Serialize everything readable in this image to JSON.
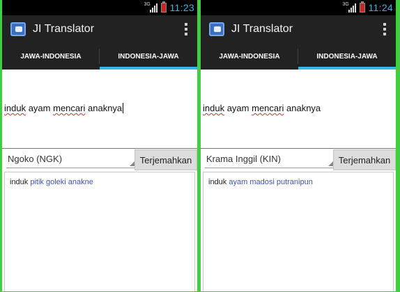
{
  "screens": [
    {
      "status": {
        "network": "3G",
        "time": "11:23"
      },
      "app_title": "JI Translator",
      "tabs": [
        "JAWA-INDONESIA",
        "INDONESIA-JAWA"
      ],
      "active_tab": 1,
      "input": {
        "words": [
          "induk",
          "ayam",
          "mencari",
          "anaknya"
        ]
      },
      "language_select": "Ngoko (NGK)",
      "translate_button": "Terjemahkan",
      "output": {
        "first": "induk",
        "rest": "pitik goleki anakne"
      }
    },
    {
      "status": {
        "network": "3G",
        "time": "11:24"
      },
      "app_title": "JI Translator",
      "tabs": [
        "JAWA-INDONESIA",
        "INDONESIA-JAWA"
      ],
      "active_tab": 1,
      "input": {
        "words": [
          "induk",
          "ayam",
          "mencari",
          "anaknya"
        ]
      },
      "language_select": "Krama Inggil (KIN)",
      "translate_button": "Terjemahkan",
      "output": {
        "first": "induk",
        "rest": "ayam madosi putranipun"
      }
    }
  ],
  "colors": {
    "accent": "#33b5e5",
    "action_bar": "#222222",
    "spell_error": "#d32f2f",
    "translation": "#3f51b5",
    "battery_low": "#c62828"
  }
}
